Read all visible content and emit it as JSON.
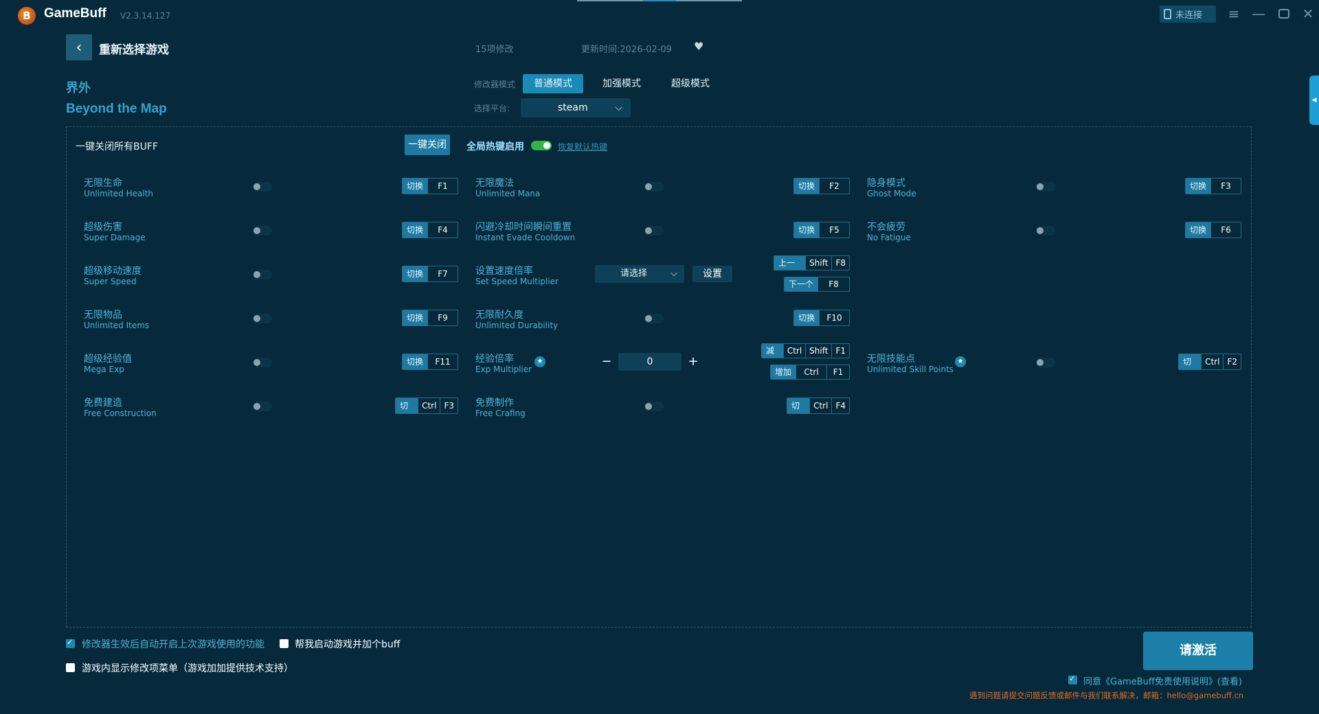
{
  "app": {
    "logo_letter": "B",
    "title": "GameBuff",
    "version": "V2.3.14.127",
    "connection": "未连接"
  },
  "header": {
    "back_label": "‹",
    "reselect": "重新选择游戏",
    "mod_count": "15项修改",
    "update_time": "更新时间:2026-02-09",
    "game_cn": "界外",
    "game_en": "Beyond the Map",
    "mode_label": "修改器模式",
    "modes": [
      "普通模式",
      "加强模式",
      "超级模式"
    ],
    "active_mode": "普通模式",
    "platform_label": "选择平台:",
    "platform": "steam"
  },
  "panel": {
    "all_buff_label": "一键关闭所有BUFF",
    "close_all": "一键关闭",
    "global_hotkey": "全局热键启用",
    "restore_default": "恢复默认热键"
  },
  "cheats": [
    {
      "cn": "无限生命",
      "en": "Unlimited Health",
      "action": "切换",
      "keys": [
        "F1"
      ]
    },
    {
      "cn": "无限魔法",
      "en": "Unlimited Mana",
      "action": "切换",
      "keys": [
        "F2"
      ]
    },
    {
      "cn": "隐身模式",
      "en": "Ghost Mode",
      "action": "切换",
      "keys": [
        "F3"
      ]
    },
    {
      "cn": "超级伤害",
      "en": "Super Damage",
      "action": "切换",
      "keys": [
        "F4"
      ]
    },
    {
      "cn": "闪避冷却时间瞬间重置",
      "en": "Instant Evade Cooldown",
      "action": "切换",
      "keys": [
        "F5"
      ]
    },
    {
      "cn": "不会疲劳",
      "en": "No Fatigue",
      "action": "切换",
      "keys": [
        "F6"
      ]
    },
    {
      "cn": "超级移动速度",
      "en": "Super Speed",
      "action": "切换",
      "keys": [
        "F7"
      ]
    },
    {
      "cn": "无限物品",
      "en": "Unlimited Items",
      "action": "切换",
      "keys": [
        "F9"
      ]
    },
    {
      "cn": "无限耐久度",
      "en": "Unlimited Durability",
      "action": "切换",
      "keys": [
        "F10"
      ]
    },
    {
      "cn": "超级经验值",
      "en": "Mega Exp",
      "action": "切换",
      "keys": [
        "F11"
      ]
    },
    {
      "cn": "无限技能点",
      "en": "Unlimited Skill Points",
      "action": "切换",
      "keys": [
        "Ctrl",
        "F2"
      ]
    },
    {
      "cn": "免费建造",
      "en": "Free Construction",
      "action": "切换",
      "keys": [
        "Ctrl",
        "F3"
      ]
    },
    {
      "cn": "免费制作",
      "en": "Free Crafing",
      "action": "切换",
      "keys": [
        "Ctrl",
        "F4"
      ]
    }
  ],
  "speed": {
    "cn": "设置速度倍率",
    "en": "Set Speed Multiplier",
    "select": "请选择",
    "set_button": "设置",
    "prev_action": "上一个",
    "prev_keys": [
      "Shift",
      "F8"
    ],
    "next_action": "下一个",
    "next_keys": [
      "F8"
    ]
  },
  "exp": {
    "cn": "经验倍率",
    "en": "Exp Multiplier",
    "value": "0",
    "minus": "−",
    "plus": "+",
    "dec_action": "减少",
    "dec_keys": [
      "Ctrl",
      "Shift",
      "F1"
    ],
    "inc_action": "增加",
    "inc_keys": [
      "Ctrl",
      "F1"
    ]
  },
  "footer": {
    "opt1": "修改器生效后自动开启上次游戏使用的功能",
    "opt2": "帮我启动游戏并加个buff",
    "opt3": "游戏内显示修改项菜单（游戏加加提供技术支持）",
    "activate": "请激活",
    "agree": "同意《GameBuff免责使用说明》(查看)",
    "contact": "遇到问题请提交问题反馈或邮件与我们联系解决，邮箱：hello@gamebuff.cn"
  },
  "icons": {
    "back": "back-arrow-icon",
    "heart": "heart-icon",
    "star": "star-icon",
    "tablet": "tablet-icon"
  },
  "colors": {
    "background": "#062a3b",
    "accent": "#1e88b3",
    "text_blue": "#4eb2da",
    "toggle_on": "#34b34a",
    "contact": "#e46a1c"
  }
}
